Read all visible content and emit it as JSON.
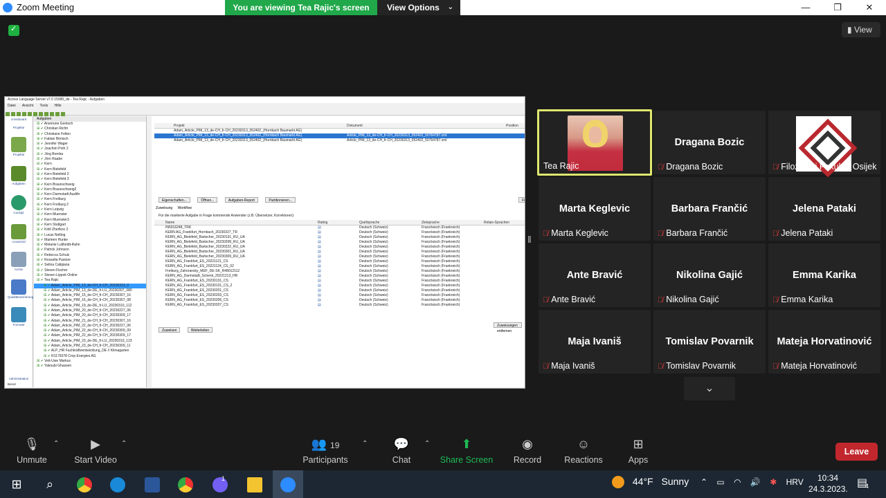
{
  "window": {
    "title": "Zoom Meeting",
    "banner": "You are viewing Tea Rajic's screen",
    "view_options": "View Options"
  },
  "meeting": {
    "view_label": "View"
  },
  "shared_app": {
    "title": "Across Language Server v7.0 15990_de - Tea Rajic - Aufgaben",
    "menu": [
      "Datei",
      "Ansicht",
      "Tools",
      "Hilfe"
    ],
    "nav_header": "crossboard",
    "nav_section": "Projekte",
    "nav_items": [
      "Projekte",
      "Aufgaben",
      "Cockpit",
      "crossGrid",
      "Archiv",
      "Qualitätssicherung",
      "Formate"
    ],
    "nav_footer": "Administration",
    "status": "Bereit",
    "tree_header": "Aufgaben",
    "tree_items": [
      "Anemone Gentsch",
      "Christian Richtr",
      "Christiane Felten",
      "Fabian Bönisch",
      "Jennifer Wager",
      "Joachim Poth 2",
      "Jörg Bomba",
      "Jörn Raabe",
      "Kern",
      "Kern Bielefeld",
      "Kern Bielefeld 2",
      "Kern Bielefeld 3",
      "Kern Braunschweig",
      "Kern Braunschweig2",
      "Kern Darmstadt Auslife",
      "Kern Freiburg",
      "Kern Freiburg 2",
      "Kern Leipzig",
      "Kern Muenster",
      "Kern Muenster3",
      "Kern Stuttgart",
      "Kirill Zherlkov 2",
      "Lucas Nolting",
      "Marleen Hunke",
      "Melanie Luitheldt-Rahn",
      "Patrick Johnson",
      "Rebecca Schulz",
      "Rossella Pastore",
      "Selina Caligiana",
      "Steven Fischer",
      "Steven Lippok Online",
      "Tea Rajic",
      "Adam_Article_PIM_13_de-CH_fr-CH_20230313_0",
      "Adam_Article_PIM_13_de-DE_fr-LU_20230307_080",
      "Adam_Article_PIM_15_de-CH_fr-CH_20230307_16",
      "Adam_Article_PIM_16_de-CH_fr-CH_20230307_08",
      "Adam_Article_PIM_19_de-DE_fr-LU_20230310_112",
      "Adam_Article_PIM_20_de-CH_fr-CH_20230227_06",
      "Adam_Article_PIM_20_de-CH_fr-CH_20230309_17",
      "Adam_Article_PIM_21_de-CH_fr-CH_20230307_16",
      "Adam_Article_PIM_22_de-CH_fr-CH_20230227_06",
      "Adam_Article_PIM_22_de-CH_fr-CH_20230309_09",
      "Adam_Article_PIM_22_de-CH_fr-CH_20230309_17",
      "Adam_Article_PIM_23_de-DE_fr-LU_20230310_123",
      "Adam_Article_PIM_23_de-CH_fr-CH_20230309_11",
      "ALP_HR Fachkräfteentwicklung_DE // Klimagarten",
      "R1179378 Crop Energies AG",
      "Veit-Uwe Markus",
      "Yakoubi Ghassen"
    ],
    "top_table": {
      "headers": [
        "Projekt",
        "Dokument",
        "Position"
      ],
      "rows": [
        [
          "Adam_Article_PIM_13_de-CH_fr-CH_20230313_052402_(Hornbach Baumarkt AG)",
          "",
          ""
        ],
        [
          "Adam_Article_PIM_13_de-CH_fr-CH_20230313_052402_(Hornbach Baumarkt AG)",
          "Article_PIM_13_de-CH_fr-CH_20230313_052402_50764787.xml",
          ""
        ],
        [
          "Adam_Article_PIM_13_de-CH_fr-CH_20230313_052402_(Hornbach Baumarkt AG)",
          "Article_PIM_13_de-CH_fr-CH_20230313_052402_50764787.xml",
          ""
        ]
      ]
    },
    "buttons": [
      "Eigenschaften...",
      "Öffnen...",
      "Aufgaben-Report",
      "Partitionieren..."
    ],
    "filter_label": "Filter",
    "tabs": [
      "Zuweisung",
      "Workflow"
    ],
    "assign_hint": "Für die markierte Aufgabe in Frage kommende Anwender (z.B. Übersetzer, Korrektoren):",
    "bottom_table": {
      "headers": [
        "Name",
        "Rating",
        "Quellsprache",
        "Zielsprache",
        "Relais-Sprachen"
      ],
      "rows": [
        [
          "IN5016248_TRK",
          "Deutsch (Schweiz)",
          "Französisch (Frankreich)"
        ],
        [
          "KERN AG_Frankfurt_Hornbach_20230327_TR",
          "Deutsch (Schweiz)",
          "Französisch (Frankreich)"
        ],
        [
          "KERN_AG_Bielefeld_Bartscher_20230131_RU_UA",
          "Deutsch (Schweiz)",
          "Französisch (Frankreich)"
        ],
        [
          "KERN_AG_Bielefeld_Bartscher_20230208_RU_UA",
          "Deutsch (Schweiz)",
          "Französisch (Frankreich)"
        ],
        [
          "KERN_AG_Bielefeld_Bartscher_20230222_RU_UA",
          "Deutsch (Schweiz)",
          "Französisch (Frankreich)"
        ],
        [
          "KERN_AG_Bielefeld_Bartscher_20230301_RU_UA",
          "Deutsch (Schweiz)",
          "Französisch (Frankreich)"
        ],
        [
          "KERN_AG_Bielefeld_Bartscher_20230309_RU_UA",
          "Deutsch (Schweiz)",
          "Französisch (Frankreich)"
        ],
        [
          "KERN_AG_Frankfurt_ES_20221121_CS",
          "Deutsch (Schweiz)",
          "Französisch (Frankreich)"
        ],
        [
          "KERN_AG_Frankfurt_ES_20221124_CS_02",
          "Deutsch (Schweiz)",
          "Französisch (Frankreich)"
        ],
        [
          "Freiburg_Zahoransky_MEF_DE-SK_R48012112",
          "Deutsch (Schweiz)",
          "Französisch (Frankreich)"
        ],
        [
          "KERN_AG_Darmstadt_Schenk_20221213_HR",
          "Deutsch (Schweiz)",
          "Französisch (Frankreich)"
        ],
        [
          "KERN_AG_Frankfurt_ES_20230131_CS",
          "Deutsch (Schweiz)",
          "Französisch (Frankreich)"
        ],
        [
          "KERN_AG_Frankfurt_ES_20230131_CS_2",
          "Deutsch (Schweiz)",
          "Französisch (Frankreich)"
        ],
        [
          "KERN_AG_Frankfurt_ES_20230201_CS",
          "Deutsch (Schweiz)",
          "Französisch (Frankreich)"
        ],
        [
          "KERN_AG_Frankfurt_ES_20230203_CS",
          "Deutsch (Schweiz)",
          "Französisch (Frankreich)"
        ],
        [
          "KERN_AG_Frankfurt_ES_20230206_CS",
          "Deutsch (Schweiz)",
          "Französisch (Frankreich)"
        ],
        [
          "KERN_AG_Frankfurt_ES_20230207_CS",
          "Deutsch (Schweiz)",
          "Französisch (Frankreich)"
        ]
      ]
    },
    "bottom_buttons": [
      "Zuweisen",
      "Weiterleiten"
    ],
    "assign_all_button": "Zuweisungen entfernen"
  },
  "participants": [
    {
      "name": "",
      "label": "Tea Rajic",
      "muted": false,
      "active_speaker": true,
      "video": true
    },
    {
      "name": "Dragana Bozic",
      "label": "Dragana Bozic",
      "muted": true
    },
    {
      "name": "",
      "label": "Filozofski Fakultet Osijek",
      "muted": true,
      "logo": true
    },
    {
      "name": "Marta Keglevic",
      "label": "Marta Keglevic",
      "muted": true
    },
    {
      "name": "Barbara Frančić",
      "label": "Barbara Frančić",
      "muted": true
    },
    {
      "name": "Jelena Pataki",
      "label": "Jelena Pataki",
      "muted": true
    },
    {
      "name": "Ante Bravić",
      "label": "Ante Bravić",
      "muted": true
    },
    {
      "name": "Nikolina Gajić",
      "label": "Nikolina Gajić",
      "muted": true
    },
    {
      "name": "Emma Karika",
      "label": "Emma Karika",
      "muted": true
    },
    {
      "name": "Maja Ivaniš",
      "label": "Maja Ivaniš",
      "muted": true
    },
    {
      "name": "Tomislav Povarnik",
      "label": "Tomislav Povarnik",
      "muted": true
    },
    {
      "name": "Mateja  Horvatinović",
      "label": "Mateja Horvatinović",
      "muted": true
    }
  ],
  "toolbar": {
    "unmute": "Unmute",
    "start_video": "Start Video",
    "participants": "Participants",
    "participants_count": "19",
    "chat": "Chat",
    "share_screen": "Share Screen",
    "record": "Record",
    "reactions": "Reactions",
    "apps": "Apps",
    "leave": "Leave"
  },
  "taskbar": {
    "weather_temp": "44°F",
    "weather_text": "Sunny",
    "language": "HRV",
    "time": "10:34",
    "date": "24.3.2023.",
    "notifications": "4",
    "viber_badge": "1"
  },
  "colors": {
    "banner_green": "#20a84a",
    "active_speaker": "#dfe86f",
    "leave_red": "#c1272d",
    "share_green": "#1db954",
    "muted_red": "#e23a3a"
  }
}
